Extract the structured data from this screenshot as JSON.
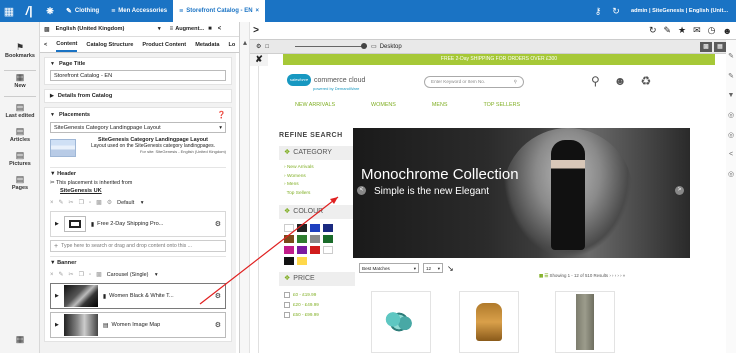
{
  "topbar": {
    "breadcrumbs": [
      {
        "label": "Clothing",
        "icon": "pencil-icon"
      },
      {
        "label": "Men Accessories",
        "icon": "list-icon"
      },
      {
        "label": "Storefront Catalog - EN",
        "icon": "list-icon"
      }
    ],
    "user": "admin | SiteGenesis | English (Unit..."
  },
  "leftrail": [
    {
      "name": "bookmarks",
      "label": "Bookmarks"
    },
    {
      "name": "new",
      "label": "New"
    },
    {
      "name": "last-edited",
      "label": "Last edited"
    },
    {
      "name": "articles",
      "label": "Articles"
    },
    {
      "name": "pictures",
      "label": "Pictures"
    },
    {
      "name": "pages",
      "label": "Pages"
    }
  ],
  "tree": {
    "language": "English (United Kingdom)",
    "augment_label": "Augment...",
    "tabs": [
      "Content",
      "Catalog Structure",
      "Product Content",
      "Metadata",
      "Lo"
    ],
    "page_title_header": "Page Title",
    "page_title_value": "Storefront Catalog - EN",
    "details_header": "Details from Catalog",
    "placements_header": "Placements",
    "placement_value": "SiteGenesis Category Landingpage Layout",
    "layout_title": "SiteGenesis Category Landingpage Layout",
    "layout_desc": "Layout used on the SiteGenesis category landingpages.",
    "layout_site": "For site: SiteGenesis - English (United Kingdom)",
    "header_label": "Header",
    "inherited_text": "This placement is inherited from",
    "inherited_link": "SiteGenesis UK",
    "default_label": "Default",
    "header_component": "Free 2-Day Shipping Pro...",
    "drop_placeholder": "Type here to search or drag and drop content onto this ...",
    "banner_label": "Banner",
    "carousel_label": "Carousel (Single)",
    "banner_items": [
      "Women Black & White T...",
      "Women Image Map"
    ]
  },
  "toolbar2": {
    "device": "Desktop"
  },
  "site": {
    "promo": "FREE 2-Day SHIPPING FOR ORDERS OVER £300",
    "logo_text": "commerce cloud",
    "logo_sub": "powered by DemandWare",
    "logo_badge": "salesforce",
    "search_placeholder": "Enter Keyword or Item No.",
    "nav": [
      "NEW ARRIVALS",
      "WOMENS",
      "MENS",
      "TOP SELLERS"
    ],
    "refine_title": "REFINE SEARCH",
    "category_title": "CATEGORY",
    "category_links": [
      "New Arrivals",
      "Womens",
      "Mens",
      "Top Sellers"
    ],
    "colour_title": "COLOUR",
    "price_title": "PRICE",
    "price_ranges": [
      "£0 - £19.99",
      "£20 - £49.99",
      "£50 - £99.99"
    ],
    "hero_title": "Monochrome Collection",
    "hero_subtitle": "Simple is the new Elegant",
    "sort_value": "Best Matches",
    "per_page": "12",
    "showing": "Showing 1 - 12 of 510 Results",
    "swatch_colors": [
      "#ffffff",
      "#222222",
      "#1e3fbf",
      "#1a2a80",
      "#7a4a1a",
      "#2e7d2e",
      "#8a8a8a",
      "#1a6b2a",
      "#c21c8a",
      "#7a1aa0",
      "#d01c1c",
      "#ffffff",
      "#111111",
      "#ffd84a"
    ]
  }
}
